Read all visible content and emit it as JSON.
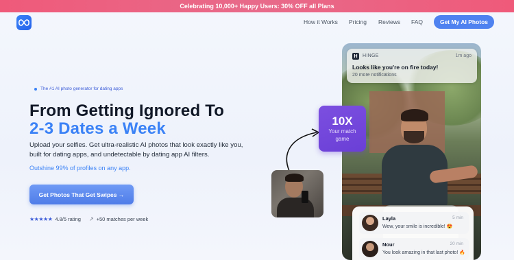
{
  "promo_banner": {
    "text": "Celebrating 10,000+ Happy Users: 30% OFF all Plans",
    "color": "#ef5a7a"
  },
  "nav": {
    "logo_icon": "infinity-icon",
    "links": [
      "How it Works",
      "Pricing",
      "Reviews",
      "FAQ"
    ],
    "cta": "Get My AI Photos",
    "accent": "#4f82f0"
  },
  "hero": {
    "tagline": "The #1 AI photo generator for dating apps",
    "headline_line1": "From Getting Ignored To",
    "headline_line2": "2-3 Dates a Week",
    "subcopy": "Upload your selfies. Get ultra-realistic AI photos that look exactly like you, built for dating apps, and undetectable by dating app AI filters.",
    "highlight": "Outshine 99% of profiles on any app.",
    "cta": "Get Photos That Get Swipes →",
    "stars": "★★★★★",
    "rating_text": "4.8/5 rating",
    "matches_icon": "arrow-trend-up-icon",
    "matches_text": "+50 matches per week"
  },
  "notification": {
    "app_icon": "H",
    "app_name": "HINGE",
    "time": "1m ago",
    "title": "Looks like you're on fire today!",
    "subtitle": "20 more notifications"
  },
  "badge": {
    "big": "10X",
    "line1": "Your match",
    "line2": "game",
    "color": "#7c4fe0"
  },
  "messages": [
    {
      "name": "Layla",
      "time": "5 min",
      "text": "Wow, your smile is incredible! 😍"
    },
    {
      "name": "Nour",
      "time": "20 min",
      "text": "You look amazing in that last photo! 🔥"
    }
  ]
}
